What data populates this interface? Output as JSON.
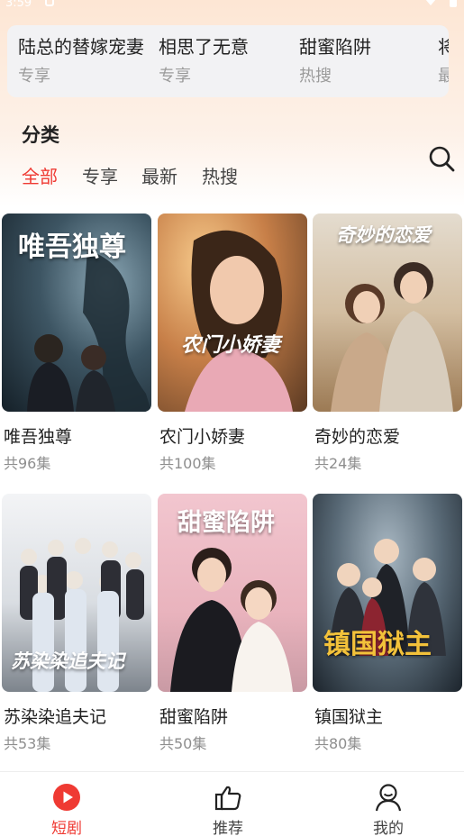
{
  "status_bar": {
    "time": "3:59"
  },
  "hot_strip": [
    {
      "title": "陆总的替嫁宠妻",
      "tag": "专享"
    },
    {
      "title": "相思了无意",
      "tag": "专享"
    },
    {
      "title": "甜蜜陷阱",
      "tag": "热搜"
    },
    {
      "title": "将",
      "tag": "最"
    }
  ],
  "category": {
    "title": "分类",
    "tabs": [
      "全部",
      "专享",
      "最新",
      "热搜"
    ],
    "active_tab": "全部"
  },
  "dramas": [
    {
      "name": "唯吾独尊",
      "episodes": "共96集",
      "poster_title": "唯吾独尊"
    },
    {
      "name": "农门小娇妻",
      "episodes": "共100集",
      "poster_title": "农门小娇妻"
    },
    {
      "name": "奇妙的恋爱",
      "episodes": "共24集",
      "poster_title": "奇妙的恋爱"
    },
    {
      "name": "苏染染追夫记",
      "episodes": "共53集",
      "poster_title": "苏染染追夫记"
    },
    {
      "name": "甜蜜陷阱",
      "episodes": "共50集",
      "poster_title": "甜蜜陷阱"
    },
    {
      "name": "镇国狱主",
      "episodes": "共80集",
      "poster_title": "镇国狱主"
    }
  ],
  "bottom_nav": [
    {
      "label": "短剧",
      "icon": "play-circle-icon",
      "active": true
    },
    {
      "label": "推荐",
      "icon": "thumbs-up-icon",
      "active": false
    },
    {
      "label": "我的",
      "icon": "user-icon",
      "active": false
    }
  ],
  "colors": {
    "accent": "#ef3a33",
    "hot_bg": "#f2f2f4"
  }
}
